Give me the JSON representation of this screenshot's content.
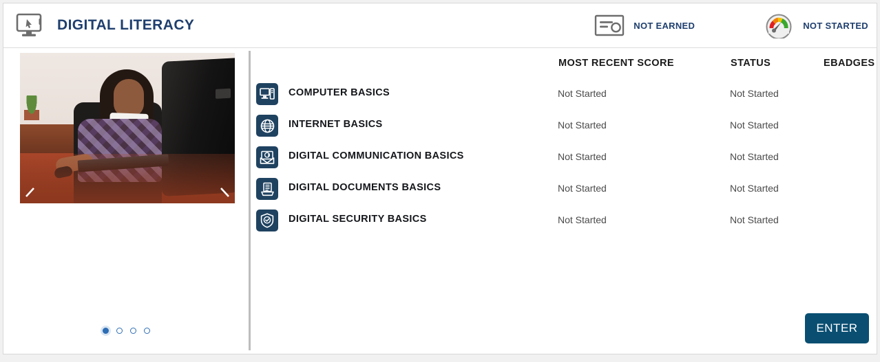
{
  "header": {
    "logo_icon": "monitor-cursor-icon",
    "title": "DIGITAL LITERACY",
    "title_color": "#1f3f6e",
    "badges": [
      {
        "icon": "certificate-icon",
        "label": "NOT EARNED"
      },
      {
        "icon": "gauge-icon",
        "label": "NOT STARTED"
      }
    ]
  },
  "carousel": {
    "image_alt": "woman working at desk with computer",
    "prev_icon": "chevron-left-icon",
    "next_icon": "chevron-right-icon",
    "dot_count": 4,
    "active_dot": 1,
    "active_color": "#2d6db4"
  },
  "table": {
    "columns": {
      "course": "",
      "score": "MOST RECENT SCORE",
      "status": "STATUS",
      "badges": "EBADGES"
    },
    "rows": [
      {
        "icon": "desktop-computer-icon",
        "label": "COMPUTER BASICS",
        "score": "Not Started",
        "status": "Not Started",
        "badges": ""
      },
      {
        "icon": "globe-icon",
        "label": "INTERNET BASICS",
        "score": "Not Started",
        "status": "Not Started",
        "badges": ""
      },
      {
        "icon": "email-at-icon",
        "label": "DIGITAL COMMUNICATION BASICS",
        "score": "Not Started",
        "status": "Not Started",
        "badges": ""
      },
      {
        "icon": "document-printer-icon",
        "label": "DIGITAL DOCUMENTS BASICS",
        "score": "Not Started",
        "status": "Not Started",
        "badges": ""
      },
      {
        "icon": "shield-check-icon",
        "label": "DIGITAL SECURITY BASICS",
        "score": "Not Started",
        "status": "Not Started",
        "badges": ""
      }
    ]
  },
  "footer": {
    "enter_label": "ENTER",
    "enter_color": "#0a4f72"
  }
}
